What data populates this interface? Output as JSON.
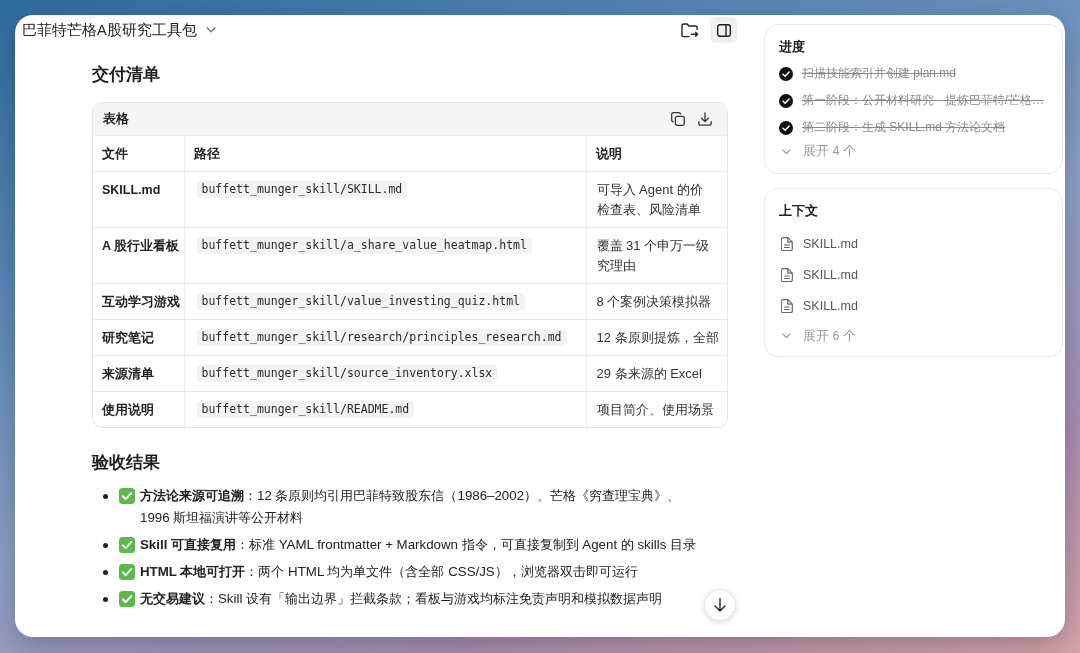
{
  "window": {
    "title": "巴菲特芒格A股研究工具包"
  },
  "deliverables": {
    "heading": "交付清单",
    "table": {
      "label": "表格",
      "columns": [
        "文件",
        "路径",
        "说明"
      ],
      "rows": [
        {
          "file": "SKILL.md",
          "path": "buffett_munger_skill/SKILL.md",
          "description_lines": [
            "可导入 Agent 的价",
            "检查表、风险清单"
          ]
        },
        {
          "file": "A 股行业看板",
          "path": "buffett_munger_skill/a_share_value_heatmap.html",
          "description_lines": [
            "覆盖 31 个申万一级",
            "究理由"
          ]
        },
        {
          "file": "互动学习游戏",
          "path": "buffett_munger_skill/value_investing_quiz.html",
          "description_lines": [
            "8 个案例决策模拟器"
          ]
        },
        {
          "file": "研究笔记",
          "path": "buffett_munger_skill/research/principles_research.md",
          "description_lines": [
            "12 条原则提炼，全部"
          ]
        },
        {
          "file": "来源清单",
          "path": "buffett_munger_skill/source_inventory.xlsx",
          "description_lines": [
            "29 条来源的 Excel"
          ]
        },
        {
          "file": "使用说明",
          "path": "buffett_munger_skill/README.md",
          "description_lines": [
            "项目简介、使用场景"
          ]
        }
      ]
    }
  },
  "acceptance": {
    "heading": "验收结果",
    "items": [
      "**方法论来源可追溯**：12 条原则均引用巴菲特致股东信（1986–2002）、芒格《穷查理宝典》、1996 斯坦福演讲等公开材料",
      "**Skill 可直接复用**：标准 YAML frontmatter + Markdown 指令，可直接复制到 Agent 的 skills 目录",
      "**HTML 本地可打开**：两个 HTML 均为单文件（含全部 CSS/JS），浏览器双击即可运行",
      "**无交易建议**：Skill 设有「输出边界」拦截条款；看板与游戏均标注免责声明和模拟数据声明"
    ]
  },
  "progress": {
    "title": "进度",
    "steps": [
      {
        "label": "扫描技能索引并创建 plan.md",
        "done": true
      },
      {
        "label": "第一阶段：公开材料研究 - 提炼巴菲特/芒格…",
        "done": true
      },
      {
        "label": "第二阶段：生成 SKILL.md 方法论文档",
        "done": true
      }
    ],
    "expand": "展开 4 个"
  },
  "context": {
    "title": "上下文",
    "files": [
      "SKILL.md",
      "SKILL.md",
      "SKILL.md"
    ],
    "expand": "展开 6 个"
  }
}
